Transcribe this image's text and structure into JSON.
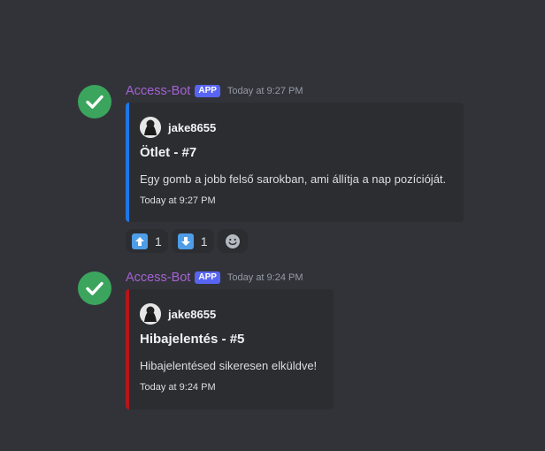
{
  "messages": [
    {
      "author": "Access-Bot",
      "tag": "APP",
      "timestamp": "Today at 9:27 PM",
      "embed": {
        "author": "jake8655",
        "title": "Ötlet - #7",
        "description": "Egy gomb a jobb felső sarokban, ami állítja a nap pozícióját.",
        "footer": "Today at 9:27 PM",
        "color": "#1f77e5"
      },
      "reactions": [
        {
          "icon": "up-arrow-icon",
          "count": "1"
        },
        {
          "icon": "down-arrow-icon",
          "count": "1"
        }
      ]
    },
    {
      "author": "Access-Bot",
      "tag": "APP",
      "timestamp": "Today at 9:24 PM",
      "embed": {
        "author": "jake8655",
        "title": "Hibajelentés - #5",
        "description": "Hibajelentésed sikeresen elküldve!",
        "footer": "Today at 9:24 PM",
        "color": "#b3161b"
      }
    }
  ],
  "colors": {
    "background": "#323339",
    "embed_background": "#2b2d31",
    "bot_avatar": "#3ba55d",
    "author_name": "#a462d4",
    "app_tag": "#5865f2"
  }
}
